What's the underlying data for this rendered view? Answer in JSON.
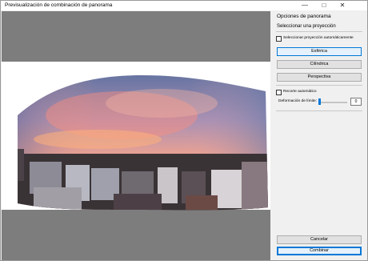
{
  "window": {
    "title": "Previsualización de combinación de panorama",
    "minimize_icon": "minimize-icon",
    "maximize_icon": "maximize-icon",
    "close_icon": "close-icon"
  },
  "panel": {
    "title": "Opciones de panorama",
    "projection_heading": "Seleccionar una proyección",
    "auto_projection_label": "Seleccionar proyección automáticamente",
    "auto_projection_checked": false,
    "projections": [
      "Esférica",
      "Cilíndrica",
      "Perspectiva"
    ],
    "selected_projection": "Esférica",
    "auto_crop_label": "Recorte automático",
    "auto_crop_checked": false,
    "boundary_warp_label": "Deformación de límite:",
    "boundary_warp_value": "0",
    "cancel_label": "Cancelar",
    "merge_label": "Combinar"
  },
  "colors": {
    "accent": "#0078d7",
    "preview_gray": "#7d7d7d",
    "panel_bg": "#f0f0f0"
  }
}
